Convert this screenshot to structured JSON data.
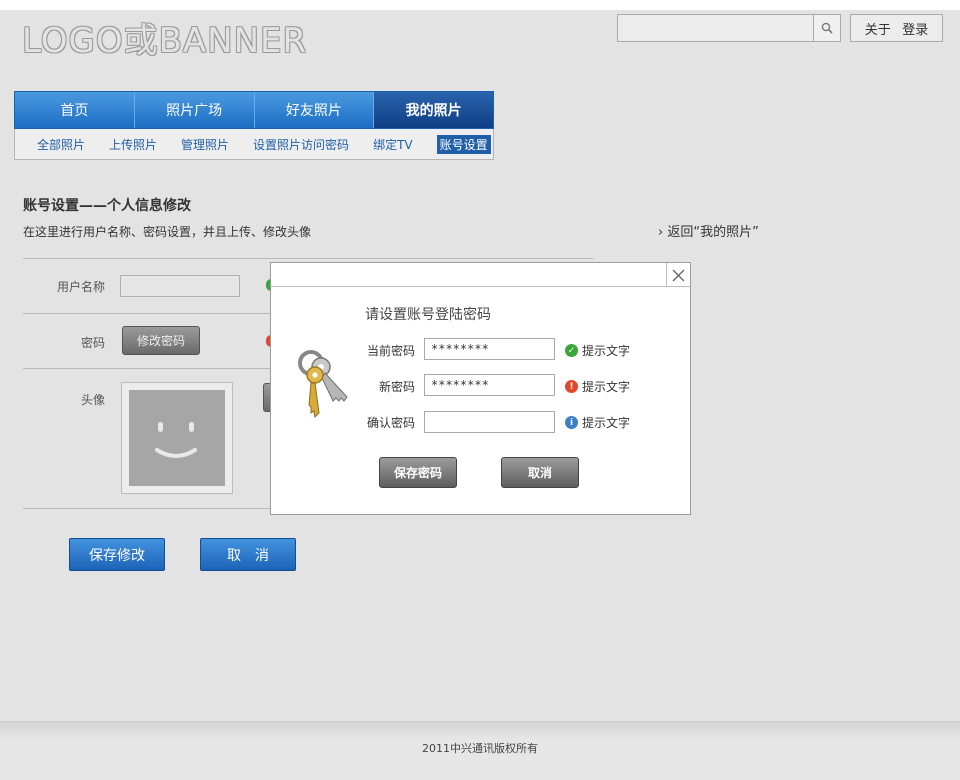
{
  "header": {
    "logo": "LOGO或BANNER",
    "search_placeholder": "",
    "search_icon": "search-icon",
    "links": [
      "关于",
      "登录"
    ]
  },
  "nav": {
    "tabs": [
      {
        "label": "首页",
        "active": false
      },
      {
        "label": "照片广场",
        "active": false
      },
      {
        "label": "好友照片",
        "active": false
      },
      {
        "label": "我的照片",
        "active": true
      }
    ],
    "subtabs": [
      {
        "label": "全部照片",
        "active": false
      },
      {
        "label": "上传照片",
        "active": false
      },
      {
        "label": "管理照片",
        "active": false
      },
      {
        "label": "设置照片访问密码",
        "active": false
      },
      {
        "label": "绑定TV",
        "active": false
      },
      {
        "label": "账号设置",
        "active": true
      }
    ]
  },
  "page": {
    "title": "账号设置——个人信息修改",
    "description": "在这里进行用户名称、密码设置，并且上传、修改头像",
    "back_link": "返回“我的照片”"
  },
  "form": {
    "username_label": "用户名称",
    "username_value": "",
    "password_label": "密码",
    "change_password_button": "修改密码",
    "avatar_label": "头像",
    "save_button": "保存修改",
    "cancel_button": "取　消"
  },
  "modal": {
    "title": "请设置账号登陆密码",
    "fields": [
      {
        "label": "当前密码",
        "value": "********",
        "hint": "提示文字",
        "status": "ok",
        "color": "#3aa63a"
      },
      {
        "label": "新密码",
        "value": "********",
        "hint": "提示文字",
        "status": "error",
        "color": "#e0472d"
      },
      {
        "label": "确认密码",
        "value": "",
        "hint": "提示文字",
        "status": "info",
        "color": "#3b7fc4"
      }
    ],
    "save_button": "保存密码",
    "cancel_button": "取消"
  },
  "footer": {
    "copyright": "2011中兴通讯版权所有"
  },
  "colors": {
    "nav_blue": "#1d6dc4",
    "nav_active": "#0f3f85",
    "link_blue": "#1f5fa8",
    "page_bg": "#e3e3e3"
  }
}
